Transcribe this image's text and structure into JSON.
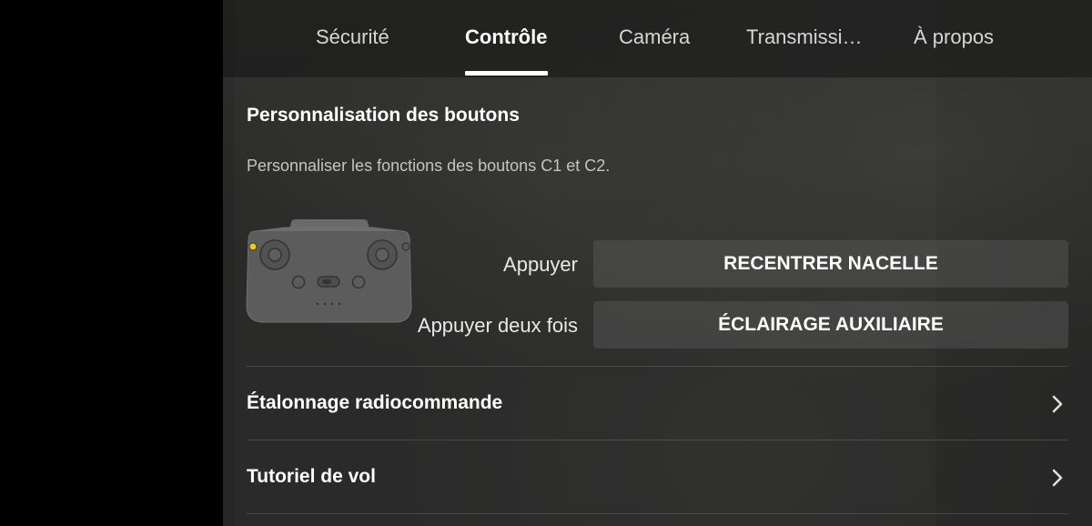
{
  "tabs": [
    {
      "label": "Sécurité",
      "active": false
    },
    {
      "label": "Contrôle",
      "active": true
    },
    {
      "label": "Caméra",
      "active": false
    },
    {
      "label": "Transmissi…",
      "active": false
    },
    {
      "label": "À propos",
      "active": false
    }
  ],
  "button_customization": {
    "title": "Personnalisation des boutons",
    "description": "Personnaliser les fonctions des boutons C1 et C2.",
    "highlight_color": "#f5c518",
    "actions": [
      {
        "label": "Appuyer",
        "value": "RECENTRER NACELLE"
      },
      {
        "label": "Appuyer deux fois",
        "value": "ÉCLAIRAGE AUXILIAIRE"
      }
    ]
  },
  "menu_rows": [
    {
      "label": "Étalonnage radiocommande",
      "icon": "chevron-right-icon"
    },
    {
      "label": "Tutoriel de vol",
      "icon": "chevron-right-icon"
    }
  ]
}
